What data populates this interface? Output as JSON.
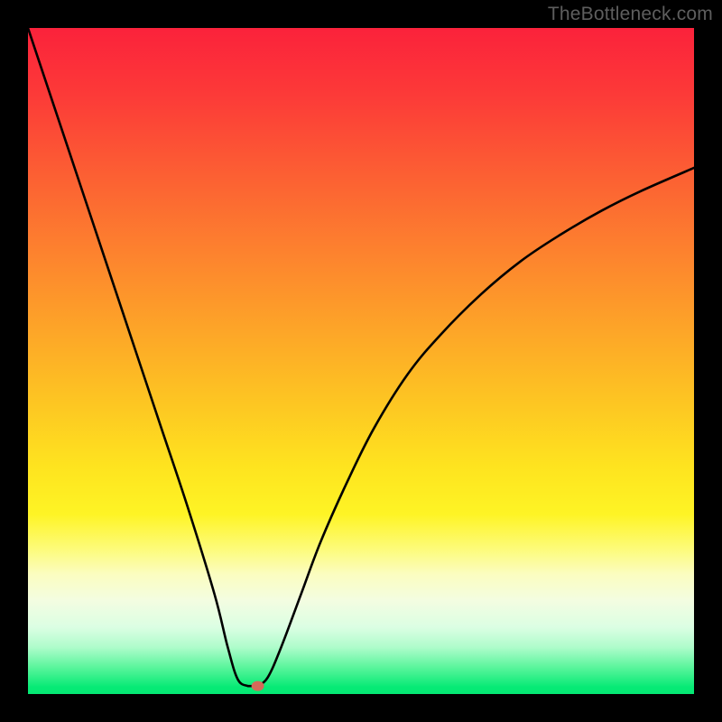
{
  "watermark": "TheBottleneck.com",
  "chart_data": {
    "type": "line",
    "title": "",
    "xlabel": "",
    "ylabel": "",
    "xlim": [
      0,
      100
    ],
    "ylim": [
      0,
      100
    ],
    "curve_description": "V-shaped bottleneck curve. Left branch descends steeply and near-linearly from the top-left corner to a flat minimum near x≈33; right branch rises from the minimum with a concave (decelerating) shape toward the upper right, ending near y≈79 at x=100.",
    "series": [
      {
        "name": "bottleneck-curve",
        "x": [
          0,
          4,
          8,
          12,
          16,
          20,
          24,
          28,
          30,
          31.5,
          33,
          34.5,
          36,
          38,
          41,
          44,
          48,
          52,
          57,
          62,
          68,
          74,
          80,
          86,
          92,
          100
        ],
        "y": [
          100,
          88,
          76,
          64,
          52,
          40,
          28,
          15,
          7,
          2.2,
          1.2,
          1.2,
          2.5,
          7,
          15,
          23,
          32,
          40,
          48,
          54,
          60,
          65,
          69,
          72.5,
          75.5,
          79
        ]
      }
    ],
    "marker": {
      "x": 34.5,
      "y": 1.2,
      "color": "#d46a59"
    },
    "gradient_stops": [
      {
        "pct": 0,
        "color": "#fb223b"
      },
      {
        "pct": 10,
        "color": "#fc3a38"
      },
      {
        "pct": 22,
        "color": "#fc5f33"
      },
      {
        "pct": 34,
        "color": "#fd832e"
      },
      {
        "pct": 47,
        "color": "#fdaa27"
      },
      {
        "pct": 57,
        "color": "#fdc822"
      },
      {
        "pct": 66,
        "color": "#fee41f"
      },
      {
        "pct": 73,
        "color": "#fef425"
      },
      {
        "pct": 78,
        "color": "#fdfb76"
      },
      {
        "pct": 82,
        "color": "#fbfdc0"
      },
      {
        "pct": 86,
        "color": "#f3fde1"
      },
      {
        "pct": 90,
        "color": "#dbfee3"
      },
      {
        "pct": 93,
        "color": "#aefccb"
      },
      {
        "pct": 96,
        "color": "#5af59c"
      },
      {
        "pct": 99,
        "color": "#06ea75"
      },
      {
        "pct": 100,
        "color": "#05e874"
      }
    ]
  }
}
